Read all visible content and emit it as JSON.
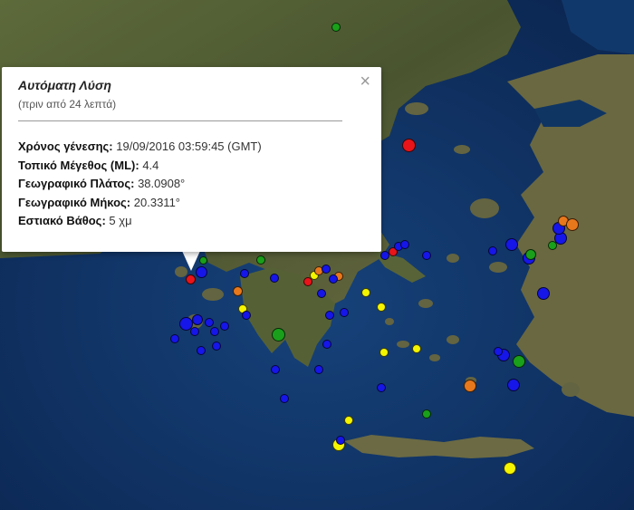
{
  "popup": {
    "title": "Αυτόματη Λύση",
    "subtitle": "(πριν από 24 λεπτά)",
    "close_symbol": "×",
    "rows": [
      {
        "label": "Χρόνος γένεσης:",
        "value": "19/09/2016  03:59:45 (GMT)"
      },
      {
        "label": "Τοπικό Μέγεθος (ML):",
        "value": "4.4"
      },
      {
        "label": "Γεωγραφικό Πλάτος:",
        "value": "38.0908°"
      },
      {
        "label": "Γεωγραφικό Μήκος:",
        "value": "20.3311°"
      },
      {
        "label": "Εστιακό Βάθος:",
        "value": "5 χμ"
      }
    ]
  },
  "colors": {
    "red": "#e8141a",
    "orange": "#e8781c",
    "yellow": "#f5f500",
    "green": "#1aa01a",
    "blue": "#1616e8",
    "sea": "#0f3563",
    "land": "#4f5b33"
  },
  "map": {
    "selected_marker": "red marker at the tip of the popup",
    "icons": [
      "close-icon"
    ]
  }
}
